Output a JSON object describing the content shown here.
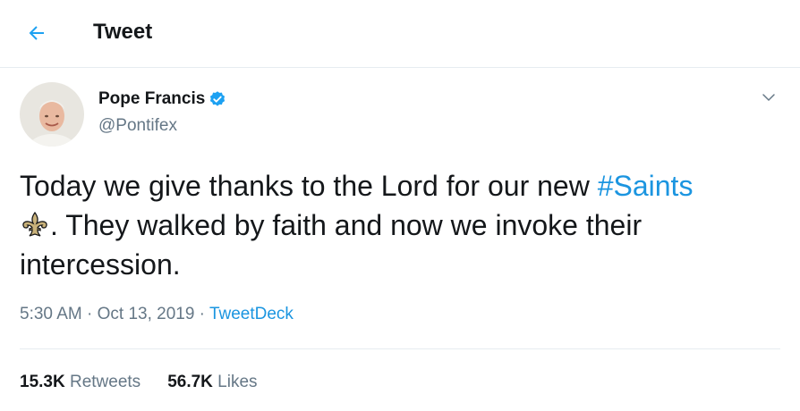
{
  "header": {
    "title": "Tweet",
    "back_icon": "arrow-left-icon",
    "accent": "#1da1f2"
  },
  "tweet": {
    "author": {
      "name": "Pope Francis",
      "handle": "@Pontifex",
      "verified": true,
      "avatar_icon": "avatar-portrait"
    },
    "text_before": "Today we give thanks to the Lord for our new ",
    "hashtag": "#Saints",
    "text_after": ". They walked by faith and now we invoke their intercession.",
    "emoji_icon": "fleur-de-lis-icon",
    "time": "5:30 AM",
    "separator": " · ",
    "date": "Oct 13, 2019",
    "source": "TweetDeck",
    "stats": {
      "retweets_count": "15.3K",
      "retweets_label": "Retweets",
      "likes_count": "56.7K",
      "likes_label": "Likes"
    }
  },
  "colors": {
    "link": "#1b95e0",
    "muted": "#657786",
    "text": "#14171a",
    "border": "#e6ecf0"
  }
}
